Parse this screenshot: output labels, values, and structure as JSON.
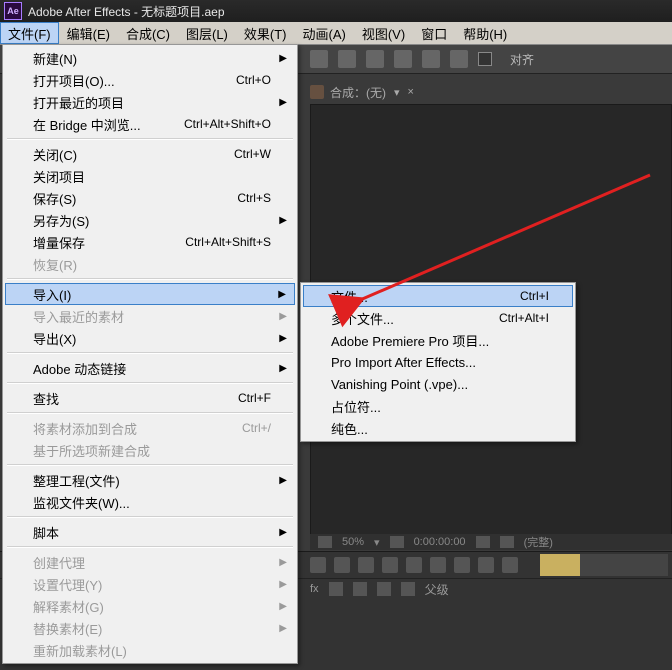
{
  "title": "Adobe After Effects - 无标题项目.aep",
  "menubar": [
    {
      "label": "文件(F)",
      "active": true
    },
    {
      "label": "编辑(E)"
    },
    {
      "label": "合成(C)"
    },
    {
      "label": "图层(L)"
    },
    {
      "label": "效果(T)"
    },
    {
      "label": "动画(A)"
    },
    {
      "label": "视图(V)"
    },
    {
      "label": "窗口"
    },
    {
      "label": "帮助(H)"
    }
  ],
  "toolbar": {
    "align_label": "对齐"
  },
  "comp_tab": {
    "label": "合成：(无)"
  },
  "viewer_footer": {
    "zoom": "50%",
    "timecode": "0:00:00:00",
    "state": "(完整)"
  },
  "timeline": {
    "columns_label": "父级"
  },
  "file_menu": [
    {
      "label": "新建(N)",
      "arrow": true
    },
    {
      "label": "打开项目(O)...",
      "shortcut": "Ctrl+O"
    },
    {
      "label": "打开最近的项目",
      "arrow": true
    },
    {
      "label": "在 Bridge 中浏览...",
      "shortcut": "Ctrl+Alt+Shift+O"
    },
    {
      "sep": true
    },
    {
      "label": "关闭(C)",
      "shortcut": "Ctrl+W"
    },
    {
      "label": "关闭项目"
    },
    {
      "label": "保存(S)",
      "shortcut": "Ctrl+S"
    },
    {
      "label": "另存为(S)",
      "arrow": true
    },
    {
      "label": "增量保存",
      "shortcut": "Ctrl+Alt+Shift+S"
    },
    {
      "label": "恢复(R)",
      "disabled": true
    },
    {
      "sep": true
    },
    {
      "label": "导入(I)",
      "arrow": true,
      "highlight": true
    },
    {
      "label": "导入最近的素材",
      "arrow": true,
      "disabled": true
    },
    {
      "label": "导出(X)",
      "arrow": true
    },
    {
      "sep": true
    },
    {
      "label": "Adobe 动态链接",
      "arrow": true
    },
    {
      "sep": true
    },
    {
      "label": "查找",
      "shortcut": "Ctrl+F"
    },
    {
      "sep": true
    },
    {
      "label": "将素材添加到合成",
      "shortcut": "Ctrl+/",
      "disabled": true
    },
    {
      "label": "基于所选项新建合成",
      "disabled": true
    },
    {
      "sep": true
    },
    {
      "label": "整理工程(文件)",
      "arrow": true
    },
    {
      "label": "监视文件夹(W)..."
    },
    {
      "sep": true
    },
    {
      "label": "脚本",
      "arrow": true
    },
    {
      "sep": true
    },
    {
      "label": "创建代理",
      "arrow": true,
      "disabled": true
    },
    {
      "label": "设置代理(Y)",
      "arrow": true,
      "disabled": true
    },
    {
      "label": "解释素材(G)",
      "arrow": true,
      "disabled": true
    },
    {
      "label": "替换素材(E)",
      "arrow": true,
      "disabled": true
    },
    {
      "label": "重新加载素材(L)",
      "disabled": true
    }
  ],
  "import_submenu": [
    {
      "label": "文件...",
      "shortcut": "Ctrl+I",
      "highlight": true
    },
    {
      "label": "多个文件...",
      "shortcut": "Ctrl+Alt+I"
    },
    {
      "label": "Adobe Premiere Pro 项目..."
    },
    {
      "label": "Pro Import After Effects..."
    },
    {
      "label": "Vanishing Point (.vpe)..."
    },
    {
      "label": "占位符..."
    },
    {
      "label": "纯色..."
    }
  ]
}
